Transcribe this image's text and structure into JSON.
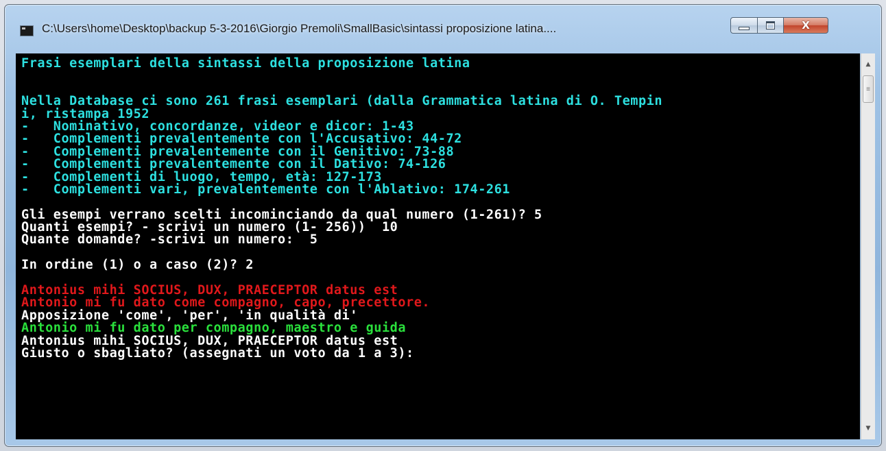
{
  "window": {
    "title": "C:\\Users\\home\\Desktop\\backup 5-3-2016\\Giorgio Premoli\\SmallBasic\\sintassi proposizione latina....",
    "controls": {
      "minimize_icon": "minimize-icon",
      "maximize_icon": "maximize-icon",
      "close_glyph": "X"
    }
  },
  "colors": {
    "cyan": "#2de0e0",
    "white": "#ffffff",
    "red": "#e0181b",
    "green": "#2ae03c",
    "background": "#000000"
  },
  "console": {
    "lines": [
      {
        "text": "Frasi esemplari della sintassi della proposizione latina",
        "color": "cyan"
      },
      {
        "text": "",
        "color": "cyan"
      },
      {
        "text": "",
        "color": "cyan"
      },
      {
        "text": "Nella Database ci sono 261 frasi esemplari (dalla Grammatica latina di O. Tempin",
        "color": "cyan"
      },
      {
        "text": "i, ristampa 1952",
        "color": "cyan"
      },
      {
        "text": "-   Nominativo, concordanze, videor e dicor: 1-43",
        "color": "cyan"
      },
      {
        "text": "-   Complementi prevalentemente con l'Accusativo: 44-72",
        "color": "cyan"
      },
      {
        "text": "-   Complementi prevalentemente con il Genitivo: 73-88",
        "color": "cyan"
      },
      {
        "text": "-   Complementi prevalentemente con il Dativo: 74-126",
        "color": "cyan"
      },
      {
        "text": "-   Complementi di luogo, tempo, età: 127-173",
        "color": "cyan"
      },
      {
        "text": "-   Complementi vari, prevalentemente con l'Ablativo: 174-261",
        "color": "cyan"
      },
      {
        "text": "",
        "color": "white"
      },
      {
        "text": "Gli esempi verrano scelti incominciando da qual numero (1-261)? 5",
        "color": "white"
      },
      {
        "text": "Quanti esempi? - scrivi un numero (1- 256))  10",
        "color": "white"
      },
      {
        "text": "Quante domande? -scrivi un numero:  5",
        "color": "white"
      },
      {
        "text": "",
        "color": "white"
      },
      {
        "text": "In ordine (1) o a caso (2)? 2",
        "color": "white"
      },
      {
        "text": "",
        "color": "white"
      },
      {
        "text": "Antonius mihi SOCIUS, DUX, PRAECEPTOR datus est",
        "color": "red"
      },
      {
        "text": "Antonio mi fu dato come compagno, capo, precettore.",
        "color": "red"
      },
      {
        "text": "Apposizione 'come', 'per', 'in qualità di'",
        "color": "white"
      },
      {
        "text": "Antonio mi fu dato per compagno, maestro e guida",
        "color": "green"
      },
      {
        "text": "Antonius mihi SOCIUS, DUX, PRAECEPTOR datus est",
        "color": "white"
      },
      {
        "text": "Giusto o sbagliato? (assegnati un voto da 1 a 3):",
        "color": "white"
      }
    ]
  },
  "scrollbar": {
    "up_icon": "scroll-up-arrow-icon",
    "down_icon": "scroll-down-arrow-icon",
    "thumb_icon": "scroll-thumb-grip-icon"
  }
}
